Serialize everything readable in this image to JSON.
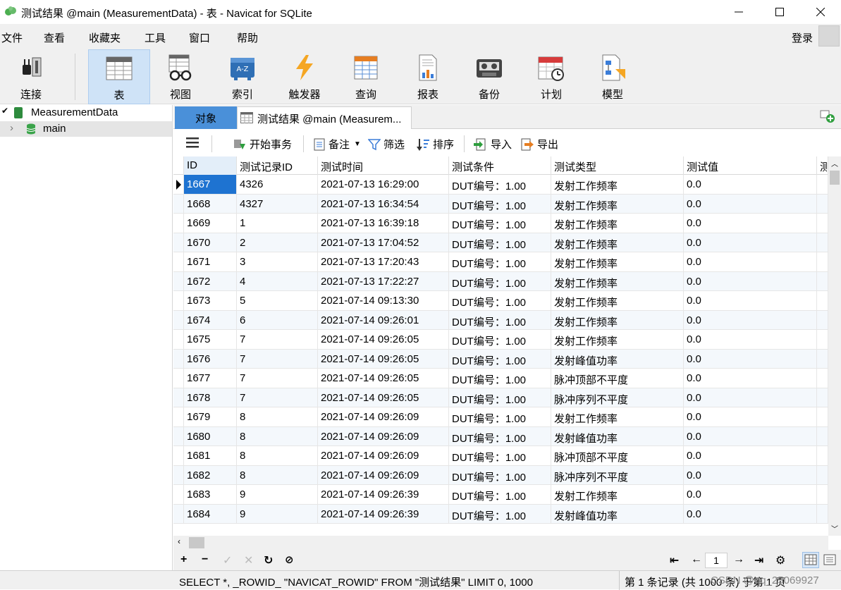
{
  "window": {
    "title": "测试结果 @main (MeasurementData) - 表 - Navicat for SQLite"
  },
  "menu": {
    "items": [
      "文件",
      "查看",
      "收藏夹",
      "工具",
      "窗口",
      "帮助"
    ],
    "login": "登录"
  },
  "toolbar": {
    "items": [
      {
        "label": "连接",
        "icon": "plug-connection-icon"
      },
      {
        "label": "表",
        "icon": "table-icon"
      },
      {
        "label": "视图",
        "icon": "view-glasses-icon"
      },
      {
        "label": "索引",
        "icon": "index-az-icon"
      },
      {
        "label": "触发器",
        "icon": "lightning-icon"
      },
      {
        "label": "查询",
        "icon": "query-table-icon"
      },
      {
        "label": "报表",
        "icon": "report-icon"
      },
      {
        "label": "备份",
        "icon": "backup-tape-icon"
      },
      {
        "label": "计划",
        "icon": "calendar-clock-icon"
      },
      {
        "label": "模型",
        "icon": "model-icon"
      }
    ],
    "active": "表"
  },
  "tree": {
    "connection": "MeasurementData",
    "database": "main"
  },
  "tabs": {
    "objects": "对象",
    "result": "测试结果 @main (Measurem..."
  },
  "grid_toolbar": {
    "begin_tx": "开始事务",
    "note": "备注",
    "filter": "筛选",
    "sort": "排序",
    "import": "导入",
    "export": "导出"
  },
  "table": {
    "columns": [
      "ID",
      "测试记录ID",
      "测试时间",
      "测试条件",
      "测试类型",
      "测试值",
      "测"
    ],
    "rows": [
      [
        "1667",
        "4326",
        "2021-07-13 16:29:00",
        "DUT编号：1.00",
        "发射工作频率",
        "0.0"
      ],
      [
        "1668",
        "4327",
        "2021-07-13 16:34:54",
        "DUT编号：1.00",
        "发射工作频率",
        "0.0"
      ],
      [
        "1669",
        "1",
        "2021-07-13 16:39:18",
        "DUT编号：1.00",
        "发射工作频率",
        "0.0"
      ],
      [
        "1670",
        "2",
        "2021-07-13 17:04:52",
        "DUT编号：1.00",
        "发射工作频率",
        "0.0"
      ],
      [
        "1671",
        "3",
        "2021-07-13 17:20:43",
        "DUT编号：1.00",
        "发射工作频率",
        "0.0"
      ],
      [
        "1672",
        "4",
        "2021-07-13 17:22:27",
        "DUT编号：1.00",
        "发射工作频率",
        "0.0"
      ],
      [
        "1673",
        "5",
        "2021-07-14 09:13:30",
        "DUT编号：1.00",
        "发射工作频率",
        "0.0"
      ],
      [
        "1674",
        "6",
        "2021-07-14 09:26:01",
        "DUT编号：1.00",
        "发射工作频率",
        "0.0"
      ],
      [
        "1675",
        "7",
        "2021-07-14 09:26:05",
        "DUT编号：1.00",
        "发射工作频率",
        "0.0"
      ],
      [
        "1676",
        "7",
        "2021-07-14 09:26:05",
        "DUT编号：1.00",
        "发射峰值功率",
        "0.0"
      ],
      [
        "1677",
        "7",
        "2021-07-14 09:26:05",
        "DUT编号：1.00",
        "脉冲顶部不平度",
        "0.0"
      ],
      [
        "1678",
        "7",
        "2021-07-14 09:26:05",
        "DUT编号：1.00",
        "脉冲序列不平度",
        "0.0"
      ],
      [
        "1679",
        "8",
        "2021-07-14 09:26:09",
        "DUT编号：1.00",
        "发射工作频率",
        "0.0"
      ],
      [
        "1680",
        "8",
        "2021-07-14 09:26:09",
        "DUT编号：1.00",
        "发射峰值功率",
        "0.0"
      ],
      [
        "1681",
        "8",
        "2021-07-14 09:26:09",
        "DUT编号：1.00",
        "脉冲顶部不平度",
        "0.0"
      ],
      [
        "1682",
        "8",
        "2021-07-14 09:26:09",
        "DUT编号：1.00",
        "脉冲序列不平度",
        "0.0"
      ],
      [
        "1683",
        "9",
        "2021-07-14 09:26:39",
        "DUT编号：1.00",
        "发射工作频率",
        "0.0"
      ],
      [
        "1684",
        "9",
        "2021-07-14 09:26:39",
        "DUT编号：1.00",
        "发射峰值功率",
        "0.0"
      ]
    ]
  },
  "pager": {
    "page": "1"
  },
  "status": {
    "sql": "SELECT *, _ROWID_ \"NAVICAT_ROWID\" FROM \"测试结果\" LIMIT 0, 1000",
    "records": "第 1 条记录 (共 1000 条) 于第 1 页",
    "watermark": "CSDN @qq_25069927"
  },
  "colors": {
    "accent": "#1e73d1",
    "tab_active": "#4a90d9",
    "toolbar_active": "#cfe3f7"
  }
}
